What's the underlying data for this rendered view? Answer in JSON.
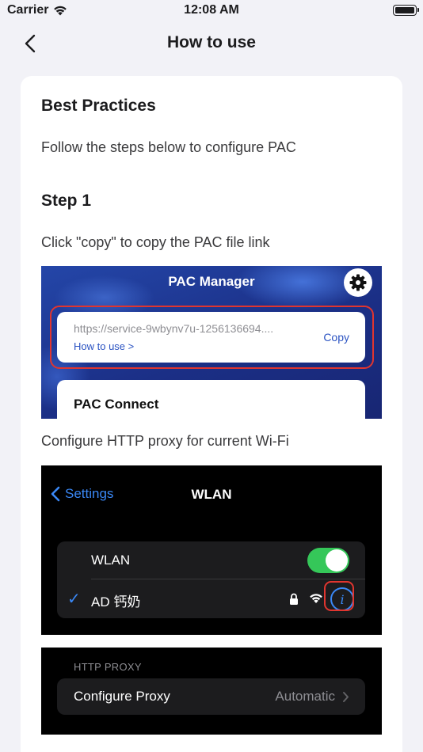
{
  "status_bar": {
    "carrier": "Carrier",
    "time": "12:08 AM"
  },
  "nav": {
    "title": "How to use"
  },
  "content": {
    "heading": "Best Practices",
    "intro": "Follow the steps below to configure PAC",
    "step_title": "Step 1",
    "step_copy_instruction": "Click \"copy\" to copy the PAC file link",
    "step_proxy_instruction": "Configure HTTP proxy for current Wi-Fi"
  },
  "screenshot_app": {
    "title": "PAC Manager",
    "url": "https://service-9wbynv7u-1256136694....",
    "how_to_use": "How to use >",
    "copy": "Copy",
    "connect_title": "PAC Connect",
    "highlight_color": "#e0352f"
  },
  "screenshot_wlan": {
    "back_label": "Settings",
    "title": "WLAN",
    "wlan_label": "WLAN",
    "wlan_enabled": true,
    "network_name": "AD 钙奶",
    "check_mark": "✓",
    "info_glyph": "i",
    "accent": "#3a88f6",
    "toggle_color": "#35c759"
  },
  "screenshot_proxy": {
    "section_header": "HTTP PROXY",
    "row_label": "Configure Proxy",
    "row_value": "Automatic"
  },
  "icons": [
    "wifi-icon",
    "battery-icon",
    "back-chevron-icon",
    "gear-icon",
    "lock-icon",
    "info-icon",
    "chevron-right-icon"
  ]
}
